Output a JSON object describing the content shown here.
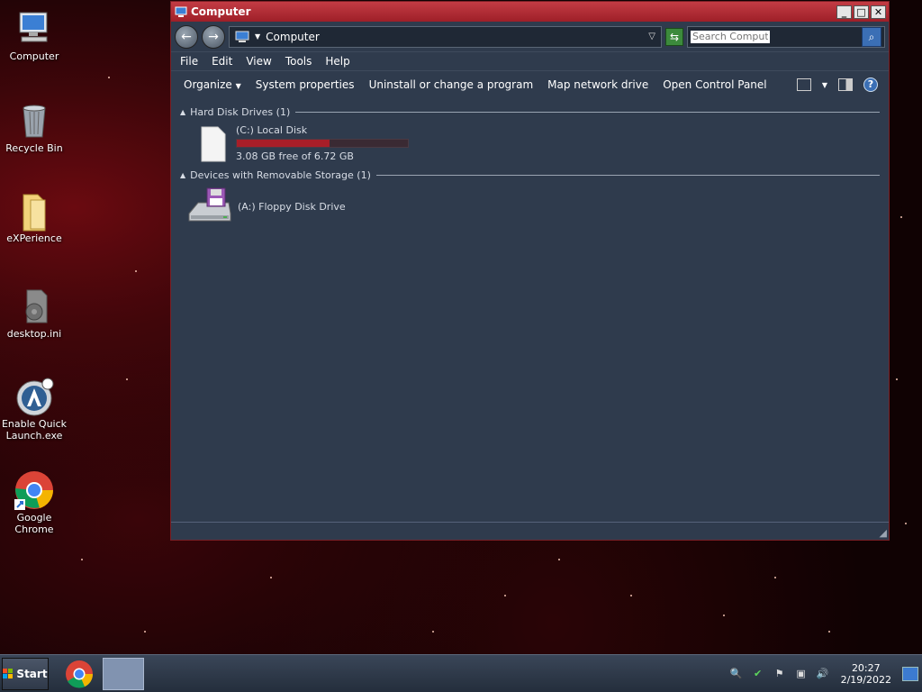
{
  "desktop": {
    "icons": [
      {
        "label": "Computer"
      },
      {
        "label": "Recycle Bin"
      },
      {
        "label": "eXPerience"
      },
      {
        "label": "desktop.ini"
      },
      {
        "label": "Enable Quick Launch.exe"
      },
      {
        "label": "Google Chrome"
      }
    ]
  },
  "window": {
    "title": "Computer",
    "address": "Computer",
    "search_placeholder": "Search Computer",
    "menu": {
      "file": "File",
      "edit": "Edit",
      "view": "View",
      "tools": "Tools",
      "help": "Help"
    },
    "commands": {
      "organize": "Organize",
      "system_properties": "System properties",
      "uninstall": "Uninstall or change a program",
      "map_drive": "Map network drive",
      "control_panel": "Open Control Panel"
    },
    "groups": {
      "hard_disks": {
        "header": "Hard Disk Drives (1)",
        "items": [
          {
            "name": "(C:) Local Disk",
            "free": "3.08 GB free of 6.72 GB",
            "used_fraction": 0.542
          }
        ]
      },
      "removable": {
        "header": "Devices with Removable Storage (1)",
        "items": [
          {
            "name": "(A:) Floppy Disk Drive"
          }
        ]
      }
    }
  },
  "taskbar": {
    "start_label": "Start",
    "time": "20:27",
    "date": "2/19/2022"
  },
  "colors": {
    "titlebar": "#b32d36",
    "window_bg": "#2f3b4d",
    "usage_bar": "#a81e28"
  }
}
